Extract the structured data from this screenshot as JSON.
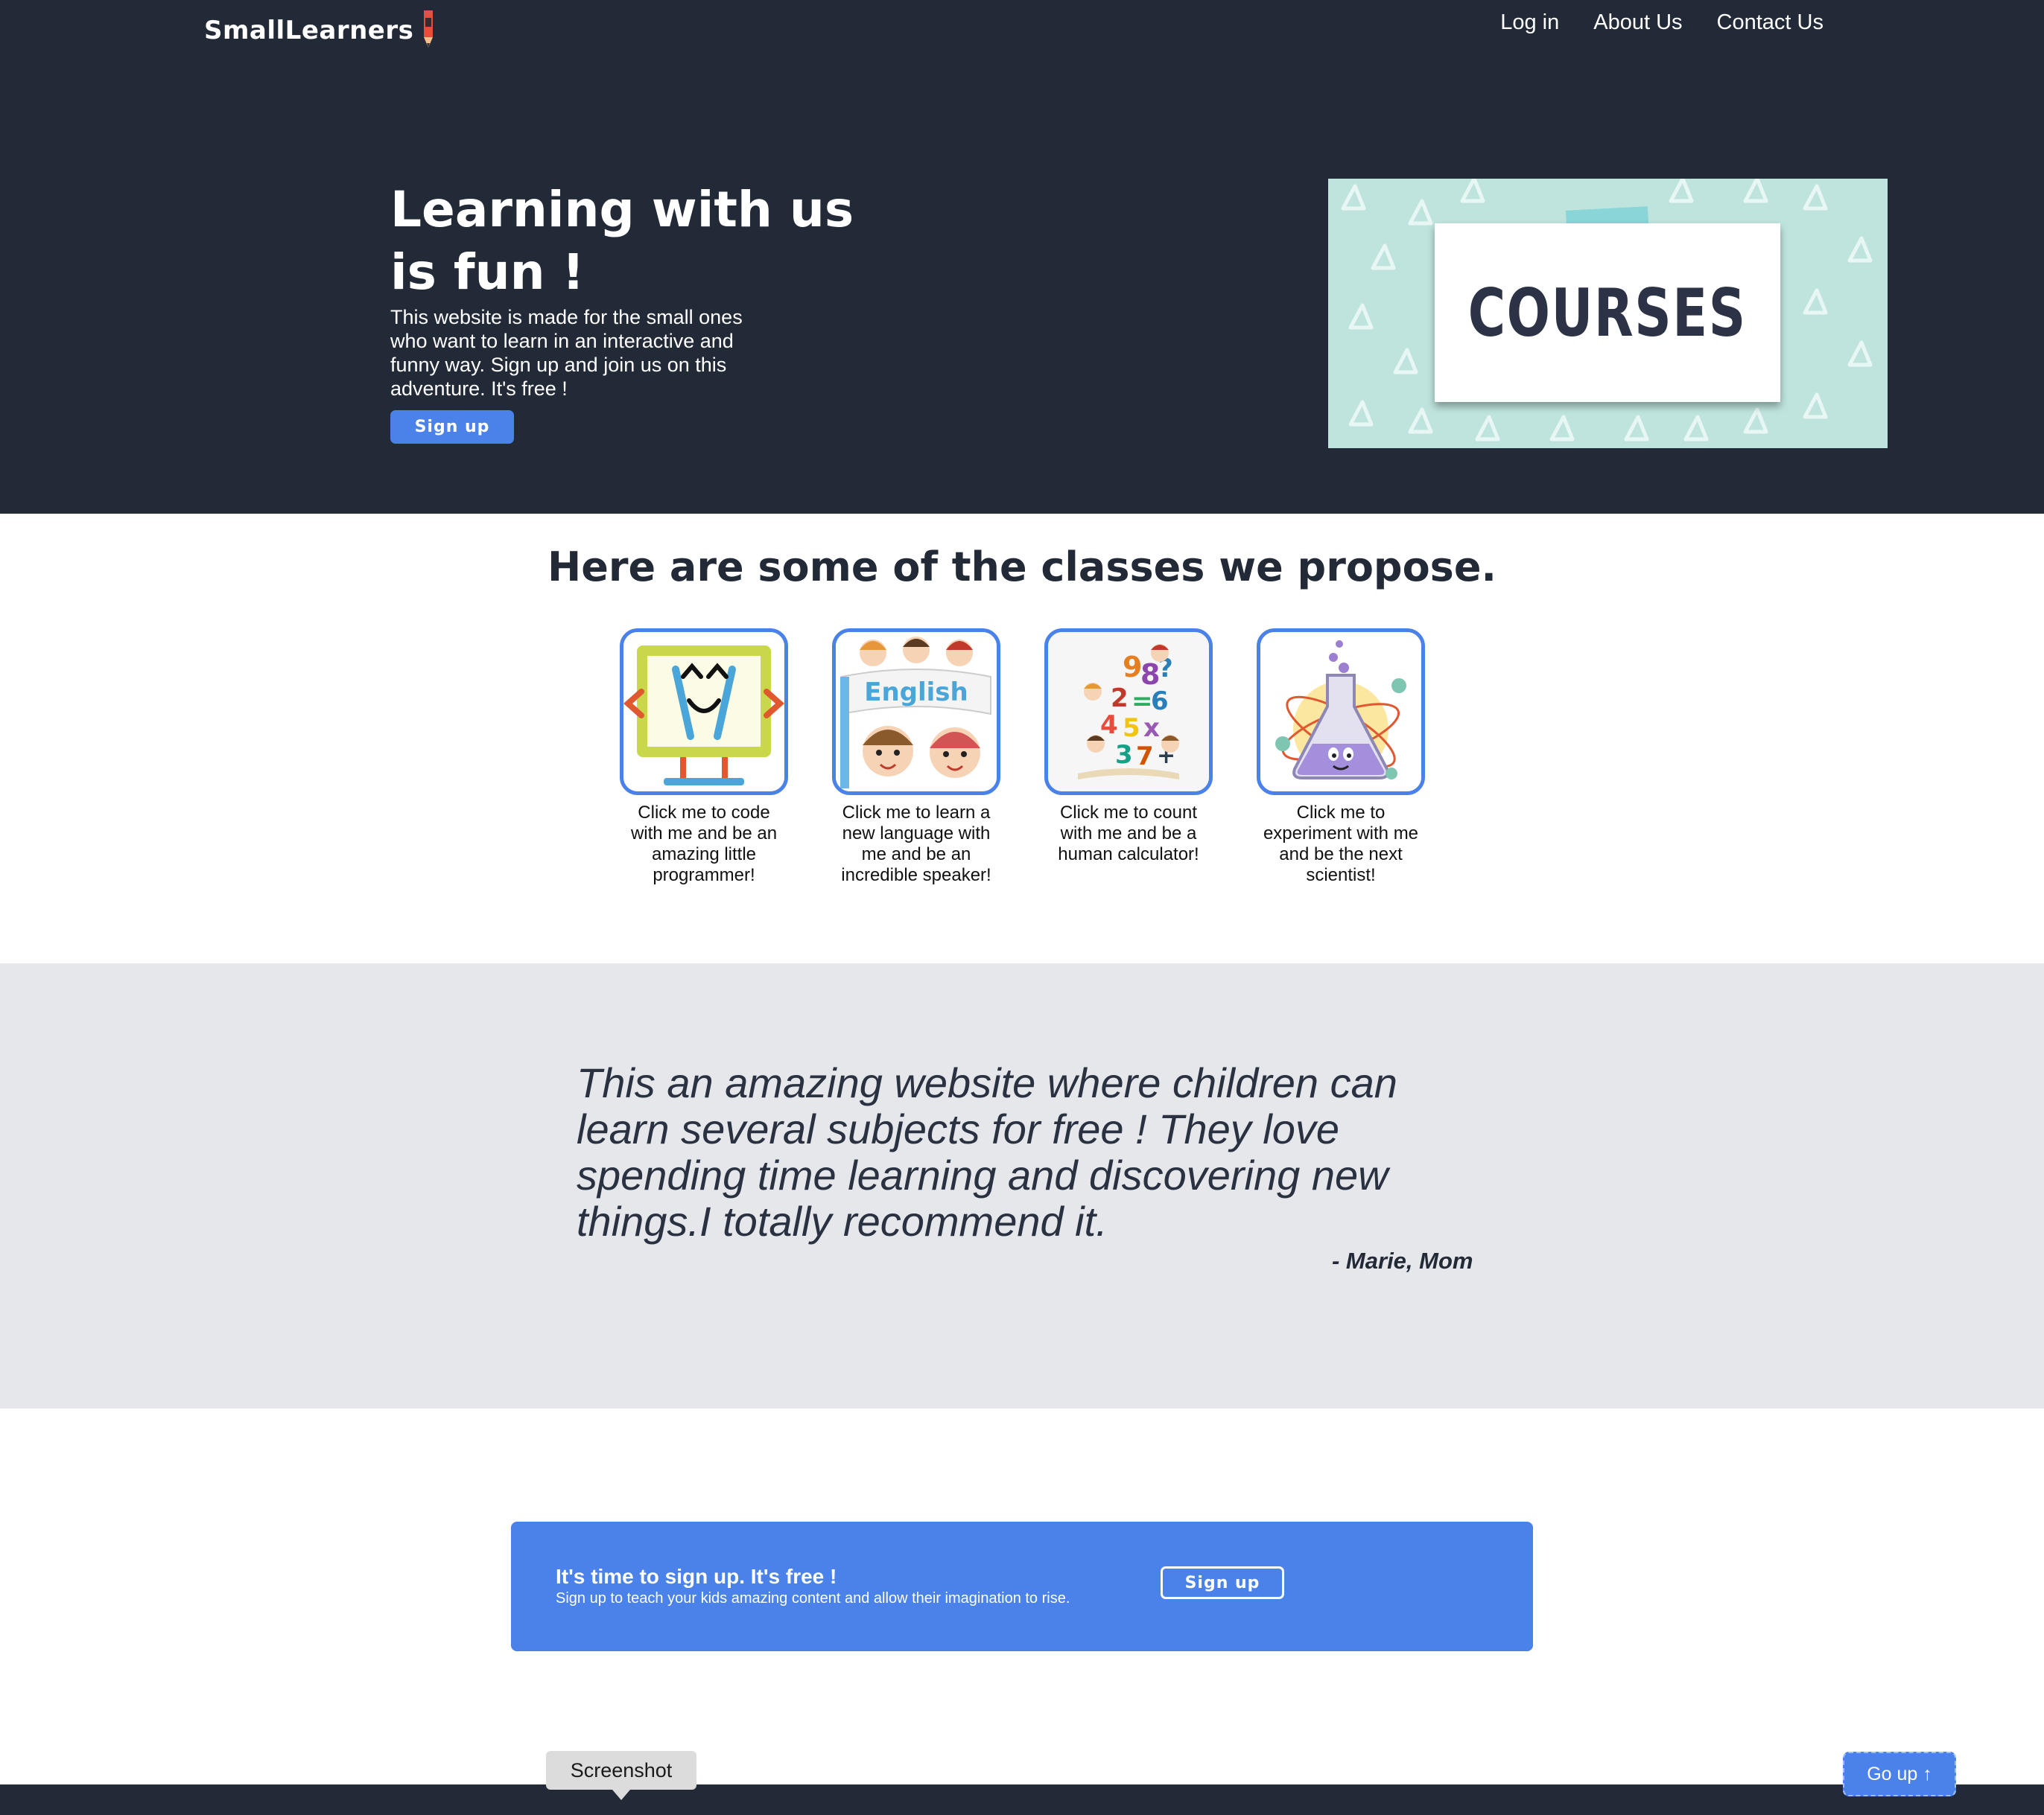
{
  "header": {
    "logo_text": "SmallLearners",
    "nav": [
      "Log in",
      "About Us",
      "Contact Us"
    ]
  },
  "hero": {
    "title_line1": "Learning with us",
    "title_line2": "is fun !",
    "description": "This website is made for the small ones who want to learn in an interactive and funny way. Sign up and join us on this adventure. It's free !",
    "signup_label": "Sign up",
    "banner_text": "COURSES"
  },
  "classes": {
    "heading": "Here are some of the classes we propose.",
    "items": [
      {
        "icon": "coding-screen-icon",
        "text": "Click me to code with me and be an amazing little programmer!"
      },
      {
        "icon": "english-kids-icon",
        "banner": "English",
        "text": "Click me to learn a new language with me and be an incredible speaker!"
      },
      {
        "icon": "math-numbers-icon",
        "text": "Click me to count with me and be a human calculator!"
      },
      {
        "icon": "science-flask-icon",
        "text": "Click me to experiment with me and be the next scientist!"
      }
    ]
  },
  "testimonial": {
    "quote": "This an amazing website where children can learn several subjects for free ! They love spending time learning and discovering new things.I totally recommend it.",
    "author": "- Marie, Mom"
  },
  "cta": {
    "title": "It's time to sign up. It's free !",
    "subtitle": "Sign up to teach your kids amazing content and allow their imagination to rise.",
    "button": "Sign up"
  },
  "overlay": {
    "tooltip": "Screenshot",
    "go_up": "Go up ↑"
  },
  "colors": {
    "dark": "#222937",
    "accent": "#4a82ea",
    "light_gray": "#e5e7eb"
  }
}
